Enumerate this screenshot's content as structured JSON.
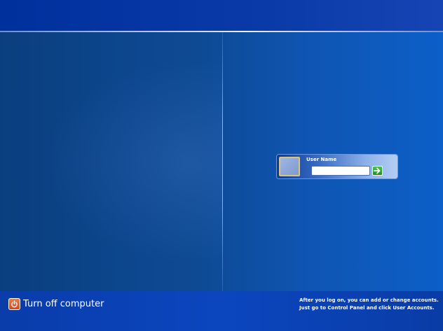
{
  "login": {
    "user_name": "User Name",
    "password_value": "",
    "go_button_icon": "arrow-right-icon"
  },
  "bottom": {
    "turn_off_label": "Turn off computer",
    "turn_off_icon": "power-icon",
    "help_line1": "After you log on, you can add or change accounts.",
    "help_line2": "Just go to Control Panel and click User Accounts."
  },
  "colors": {
    "background_blue": "#0e4a94",
    "top_band": "#00309c",
    "bottom_bar": "#0b46bf",
    "go_button_green": "#2fa82f",
    "power_orange": "#e2582a"
  }
}
